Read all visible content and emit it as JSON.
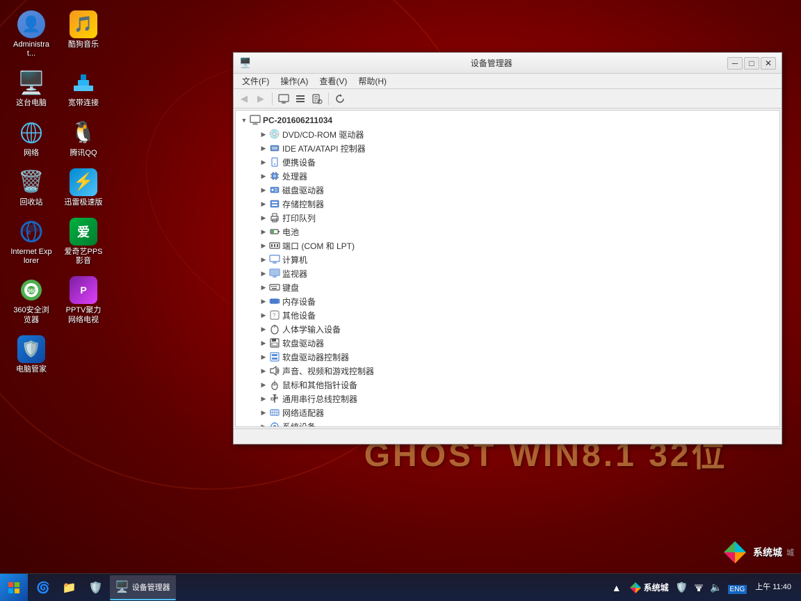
{
  "desktop": {
    "background_desc": "Red gradient desktop",
    "ghost_text": "GHOST  WIN8.1  32位"
  },
  "icons": [
    {
      "id": "admin",
      "label": "Administrat...",
      "emoji": "👤",
      "color": "#3a7bd5"
    },
    {
      "id": "kkmusic",
      "label": "酷狗音乐",
      "emoji": "🎵",
      "color": "#f7971e"
    },
    {
      "id": "computer",
      "label": "这台电脑",
      "emoji": "🖥️",
      "color": "#4fc3f7"
    },
    {
      "id": "broadband",
      "label": "宽带连接",
      "emoji": "🌐",
      "color": "#4fc3f7"
    },
    {
      "id": "network",
      "label": "网络",
      "emoji": "🌐",
      "color": "#4fc3f7"
    },
    {
      "id": "qq",
      "label": "腾讯QQ",
      "emoji": "🐧",
      "color": "#ffd200"
    },
    {
      "id": "recycle",
      "label": "回收站",
      "emoji": "🗑️",
      "color": "#gray"
    },
    {
      "id": "thunder",
      "label": "迅雷极速版",
      "emoji": "⚡",
      "color": "#4facfe"
    },
    {
      "id": "ie",
      "label": "Internet Explorer",
      "emoji": "🌀",
      "color": "#1565c0"
    },
    {
      "id": "iqiyi",
      "label": "爱奇艺PPS影音",
      "emoji": "▶️",
      "color": "#00b140"
    },
    {
      "id": "360",
      "label": "360安全浏览器",
      "emoji": "🛡️",
      "color": "#4caf50"
    },
    {
      "id": "pptv",
      "label": "PPTV聚力 网络电视",
      "emoji": "📺",
      "color": "#e040fb"
    },
    {
      "id": "pcmgr",
      "label": "电脑管家",
      "emoji": "🔒",
      "color": "#1976d2"
    }
  ],
  "window": {
    "title": "设备管理器",
    "title_icon": "🖥️",
    "menu": {
      "items": [
        "文件(F)",
        "操作(A)",
        "查看(V)",
        "帮助(H)"
      ]
    },
    "toolbar": {
      "buttons": [
        "←",
        "→",
        "🖥️",
        "📋",
        "📁",
        "⚙️"
      ]
    },
    "tree": {
      "root": "PC-201606211034",
      "items": [
        {
          "label": "DVD/CD-ROM 驱动器",
          "icon": "💿"
        },
        {
          "label": "IDE ATA/ATAPI 控制器",
          "icon": "💾"
        },
        {
          "label": "便携设备",
          "icon": "📱"
        },
        {
          "label": "处理器",
          "icon": "🖥️"
        },
        {
          "label": "磁盘驱动器",
          "icon": "💽"
        },
        {
          "label": "存储控制器",
          "icon": "📦"
        },
        {
          "label": "打印队列",
          "icon": "🖨️"
        },
        {
          "label": "电池",
          "icon": "🔋"
        },
        {
          "label": "端口 (COM 和 LPT)",
          "icon": "🔌"
        },
        {
          "label": "计算机",
          "icon": "🖥️"
        },
        {
          "label": "监视器",
          "icon": "🖥️"
        },
        {
          "label": "键盘",
          "icon": "⌨️"
        },
        {
          "label": "内存设备",
          "icon": "💾"
        },
        {
          "label": "其他设备",
          "icon": "📦"
        },
        {
          "label": "人体学输入设备",
          "icon": "🖱️"
        },
        {
          "label": "软盘驱动器",
          "icon": "💾"
        },
        {
          "label": "软盘驱动器控制器",
          "icon": "💾"
        },
        {
          "label": "声音、视频和游戏控制器",
          "icon": "🔊"
        },
        {
          "label": "鼠标和其他指针设备",
          "icon": "🖱️"
        },
        {
          "label": "通用串行总线控制器",
          "icon": "🔌"
        },
        {
          "label": "网络适配器",
          "icon": "🌐"
        },
        {
          "label": "系统设备",
          "icon": "⚙️"
        }
      ]
    }
  },
  "taskbar": {
    "start_icon": "⊞",
    "items": [
      {
        "label": "",
        "icon": "🌀",
        "id": "ie-taskbar"
      },
      {
        "label": "",
        "icon": "📁",
        "id": "explorer-taskbar"
      },
      {
        "label": "",
        "icon": "🛡️",
        "id": "shield-taskbar"
      },
      {
        "label": "设备管理器",
        "icon": "🖥️",
        "id": "devmgr-taskbar",
        "active": true
      }
    ],
    "tray": {
      "lang": "ENG",
      "time": "上午 11:40",
      "icons": [
        "▲",
        "🔈",
        "🌐",
        "🔋"
      ],
      "syscity": "系统城"
    }
  }
}
